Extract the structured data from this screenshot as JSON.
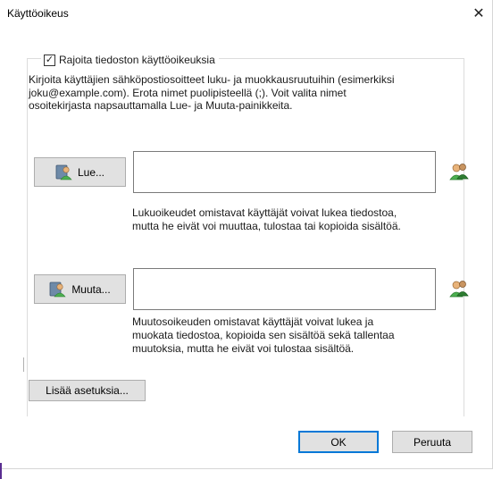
{
  "window": {
    "title": "Käyttöoikeus",
    "close_glyph": "✕"
  },
  "restrict": {
    "checked": true,
    "check_glyph": "✓",
    "label": "Rajoita tiedoston käyttöoikeuksia"
  },
  "description": [
    "Kirjoita käyttäjien sähköpostiosoitteet luku- ja muokkausruutuihin (esimerkiksi",
    "joku@example.com). Erota nimet puolipisteellä (;). Voit valita nimet",
    "osoitekirjasta napsauttamalla Lue- ja Muuta-painikkeita."
  ],
  "read": {
    "button_label": "Lue...",
    "value": "",
    "note": [
      "Lukuoikeudet omistavat käyttäjät voivat lukea tiedostoa,",
      "mutta he eivät voi muuttaa, tulostaa tai kopioida sisältöä."
    ]
  },
  "change": {
    "button_label": "Muuta...",
    "value": "",
    "note": [
      "Muutosoikeuden omistavat käyttäjät voivat lukea ja",
      "muokata tiedostoa, kopioida sen sisältöä sekä tallentaa",
      "muutoksia, mutta he eivät voi tulostaa sisältöä."
    ]
  },
  "more_button": "Lisää asetuksia...",
  "ok_button": "OK",
  "cancel_button": "Peruuta",
  "icons": {
    "user": "user-icon",
    "address_book": "address-book-icon"
  },
  "colors": {
    "accent": "#0078d7",
    "button_bg": "#e1e1e1"
  }
}
